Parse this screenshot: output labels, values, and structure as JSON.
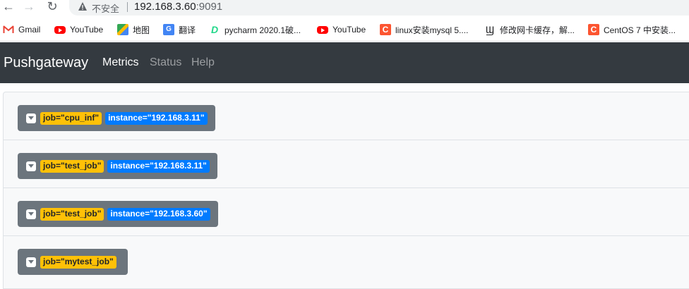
{
  "browser": {
    "insecure_label": "不安全",
    "url_host": "192.168.3.60",
    "url_port": ":9091"
  },
  "bookmarks": [
    {
      "label": "Gmail",
      "icon": "gmail-icon"
    },
    {
      "label": "YouTube",
      "icon": "youtube-icon"
    },
    {
      "label": "地图",
      "icon": "maps-icon"
    },
    {
      "label": "翻译",
      "icon": "translate-icon"
    },
    {
      "label": "pycharm 2020.1破...",
      "icon": "pycharm-icon"
    },
    {
      "label": "YouTube",
      "icon": "youtube-icon"
    },
    {
      "label": "linux安装mysql 5....",
      "icon": "csdn-icon"
    },
    {
      "label": "修改网卡缓存，解...",
      "icon": "wave-icon"
    },
    {
      "label": "CentOS 7 中安装...",
      "icon": "csdn-icon"
    }
  ],
  "navbar": {
    "brand": "Pushgateway",
    "links": [
      "Metrics",
      "Status",
      "Help"
    ]
  },
  "groups": [
    {
      "job": "job=\"cpu_inf\"",
      "instance": "instance=\"192.168.3.11\""
    },
    {
      "job": "job=\"test_job\"",
      "instance": "instance=\"192.168.3.11\""
    },
    {
      "job": "job=\"test_job\"",
      "instance": "instance=\"192.168.3.60\""
    },
    {
      "job": "job=\"mytest_job\"",
      "instance": ""
    }
  ],
  "colors": {
    "navbar_bg": "#343a40",
    "group_button": "#6c757d",
    "job_badge": "#ffc107",
    "instance_badge": "#007bff"
  }
}
